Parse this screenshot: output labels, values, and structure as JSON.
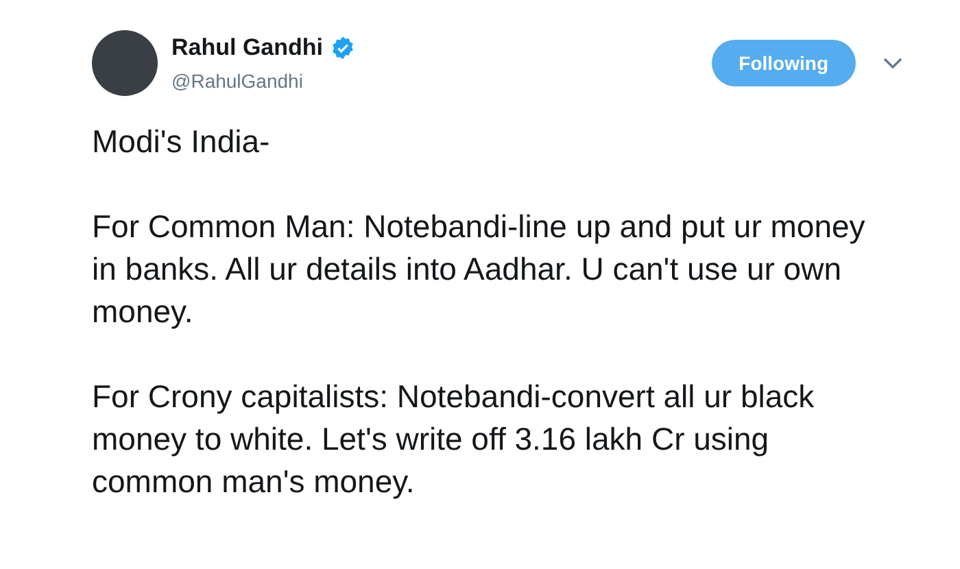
{
  "author": {
    "name": "Rahul Gandhi",
    "verified": true,
    "handle": "@RahulGandhi"
  },
  "follow_button": {
    "label": "Following",
    "following": true
  },
  "tweet": {
    "paragraphs": [
      "Modi's India-",
      "For Common Man: Notebandi-line up and put ur money in banks. All ur details into Aadhar. U can't use ur own money.",
      "For Crony capitalists: Notebandi-convert all ur black money to white. Let's write off 3.16 lakh Cr using common man's money."
    ]
  }
}
